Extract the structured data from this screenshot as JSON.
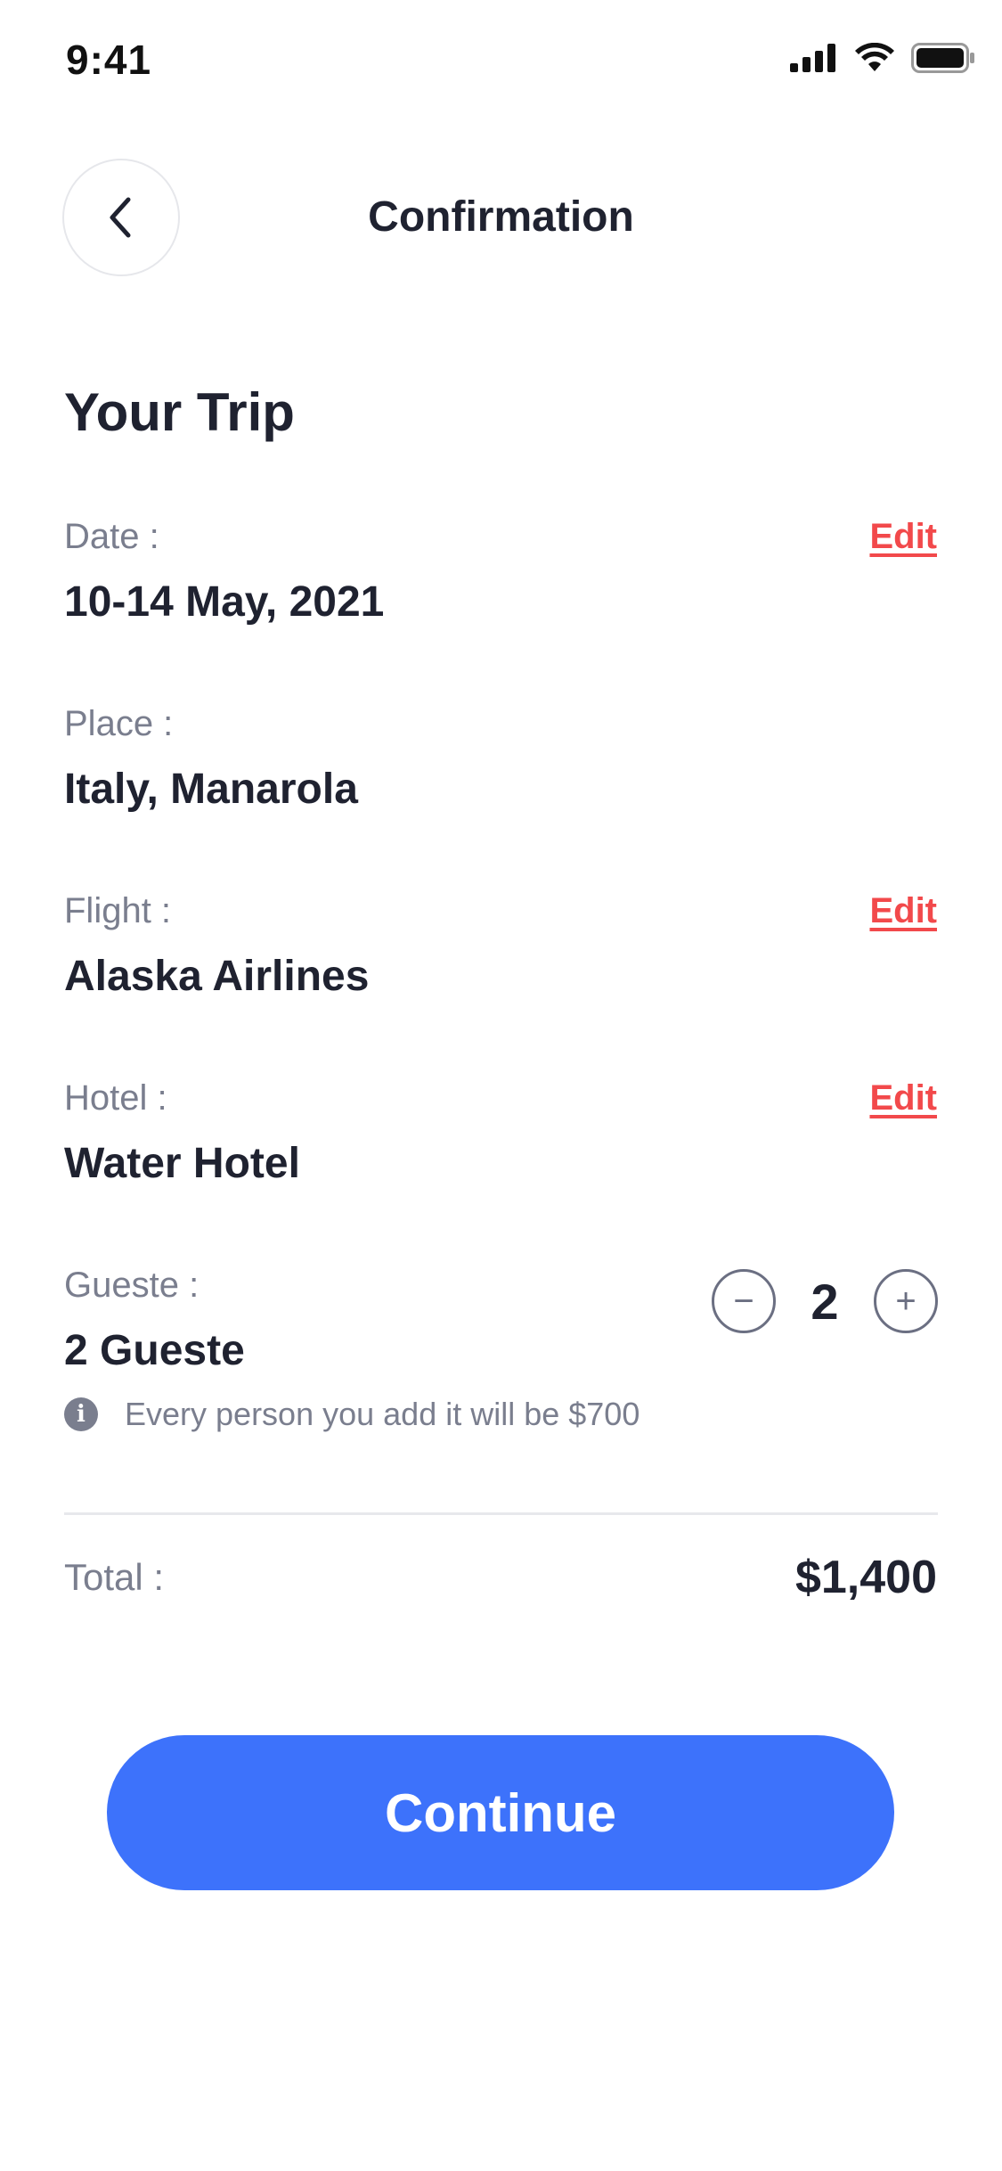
{
  "status_bar": {
    "time": "9:41"
  },
  "header": {
    "title": "Confirmation"
  },
  "trip": {
    "section_title": "Your Trip",
    "date": {
      "label": "Date :",
      "value": "10-14 May, 2021",
      "edit": "Edit"
    },
    "place": {
      "label": "Place :",
      "value": "Italy, Manarola"
    },
    "flight": {
      "label": "Flight :",
      "value": "Alaska Airlines",
      "edit": "Edit"
    },
    "hotel": {
      "label": "Hotel :",
      "value": "Water Hotel",
      "edit": "Edit"
    },
    "guests": {
      "label": "Gueste :",
      "value": "2 Gueste",
      "count": "2",
      "minus": "−",
      "plus": "+",
      "info_icon": "i",
      "info": "Every person you add it will be $700"
    }
  },
  "total": {
    "label": "Total :",
    "value": "$1,400"
  },
  "actions": {
    "continue": "Continue"
  },
  "colors": {
    "accent": "#3d72fb",
    "edit": "#f2494b",
    "text": "#1f2230",
    "muted": "#7a7e8e"
  },
  "icons": [
    "cellular-signal-icon",
    "wifi-icon",
    "battery-icon",
    "chevron-left-icon",
    "info-icon"
  ]
}
